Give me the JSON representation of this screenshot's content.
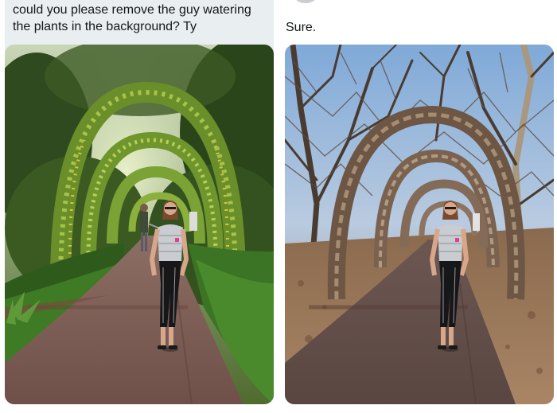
{
  "request": {
    "line1": "could you please remove the guy watering",
    "line2": "the plants in the background? Ty"
  },
  "reply": {
    "text": "Sure."
  },
  "images": {
    "before": "photo-original-garden-with-gardener",
    "after": "photo-edited-dead-trees"
  },
  "colors": {
    "bubble": "#e9eef1",
    "text": "#14171a"
  }
}
